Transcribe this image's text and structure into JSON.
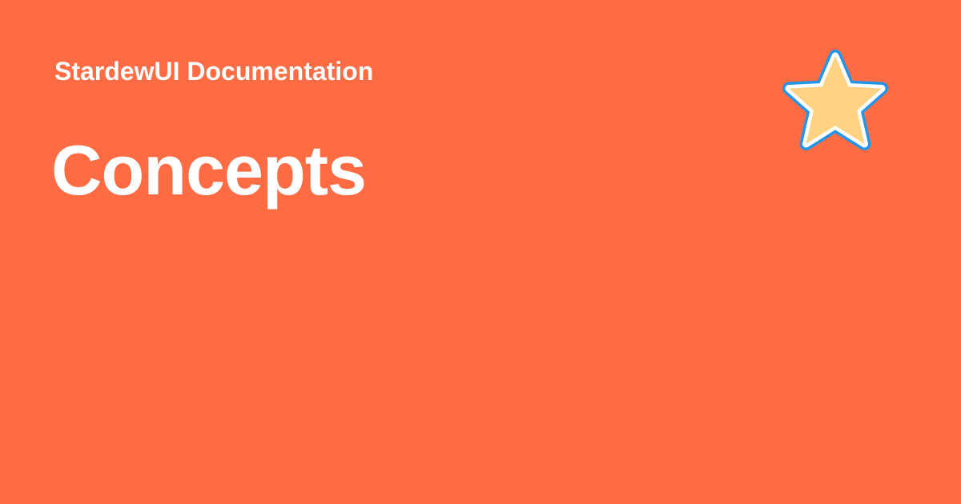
{
  "site": {
    "name": "StardewUI Documentation"
  },
  "page": {
    "title": "Concepts"
  },
  "logo": {
    "icon": "star-icon"
  },
  "colors": {
    "background": "#ff6b42",
    "text": "#ffffff",
    "star_fill": "#ffd284",
    "star_outline": "#ffffff",
    "star_border": "#2196e8"
  }
}
